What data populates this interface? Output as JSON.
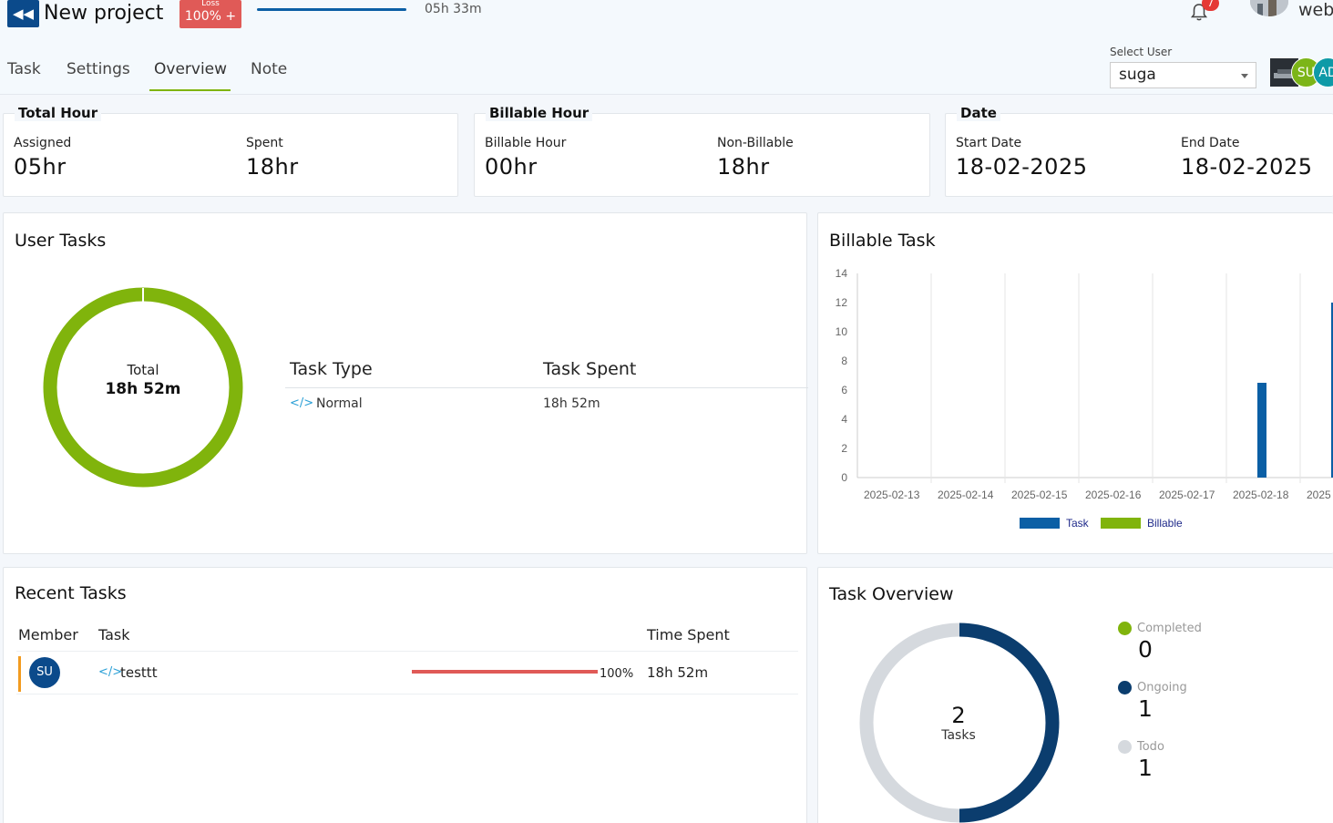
{
  "header": {
    "back_icon": "double-chevron-left-icon",
    "project_title": "New project",
    "loss_label": "Loss",
    "loss_value": "100% +",
    "progress_percent": 100,
    "elapsed_time": "05h 33m",
    "notification_count": "7",
    "user_name": "web"
  },
  "tabs": [
    {
      "label": "Task"
    },
    {
      "label": "Settings"
    },
    {
      "label": "Overview",
      "active": true
    },
    {
      "label": "Note"
    }
  ],
  "user_select": {
    "label": "Select User",
    "value": "suga"
  },
  "avatars": [
    {
      "initials": "",
      "color": "#2a2f35"
    },
    {
      "initials": "SU",
      "color": "#7cb518"
    },
    {
      "initials": "AD",
      "color": "#0e9aa7"
    }
  ],
  "total_hour": {
    "title": "Total Hour",
    "assigned_label": "Assigned",
    "assigned_value": "05hr",
    "spent_label": "Spent",
    "spent_value": "18hr"
  },
  "billable_hour": {
    "title": "Billable Hour",
    "billable_label": "Billable Hour",
    "billable_value": "00hr",
    "nonbillable_label": "Non-Billable",
    "nonbillable_value": "18hr"
  },
  "date": {
    "title": "Date",
    "start_label": "Start Date",
    "start_value": "18-02-2025",
    "end_label": "End Date",
    "end_value": "18-02-2025"
  },
  "user_tasks": {
    "title": "User Tasks",
    "center_label": "Total",
    "center_value": "18h 52m",
    "ring_color": "#80b40c",
    "table_headers": [
      "Task Type",
      "Task Spent"
    ],
    "rows": [
      {
        "icon": "code-icon",
        "type": "Normal",
        "spent": "18h 52m"
      }
    ]
  },
  "billable_task": {
    "title": "Billable Task"
  },
  "chart_data": {
    "type": "bar",
    "categories": [
      "2025-02-13",
      "2025-02-14",
      "2025-02-15",
      "2025-02-16",
      "2025-02-17",
      "2025-02-18",
      "2025"
    ],
    "series": [
      {
        "name": "Task",
        "color": "#0b5fa5",
        "values": [
          0,
          0,
          0,
          0,
          0,
          6.5,
          12
        ]
      },
      {
        "name": "Billable",
        "color": "#80b40c",
        "values": [
          0,
          0,
          0,
          0,
          0,
          0,
          0
        ]
      }
    ],
    "yticks": [
      "0",
      "2",
      "4",
      "6",
      "8",
      "10",
      "12",
      "14"
    ],
    "ylim": [
      0,
      14
    ],
    "grid": true,
    "legend": "bottom"
  },
  "recent_tasks": {
    "title": "Recent Tasks",
    "headers": [
      "Member",
      "Task",
      "Time Spent"
    ],
    "rows": [
      {
        "member": "SU",
        "icon": "code-icon",
        "task": "testtt",
        "progress_label": "100%",
        "progress": 100,
        "time": "18h 52m"
      }
    ]
  },
  "task_overview": {
    "title": "Task Overview",
    "center_value": "2",
    "center_label": "Tasks",
    "items": [
      {
        "label": "Completed",
        "value": "0",
        "color": "#80b40c"
      },
      {
        "label": "Ongoing",
        "value": "1",
        "color": "#0b3d6e"
      },
      {
        "label": "Todo",
        "value": "1",
        "color": "#d5d9de"
      }
    ]
  }
}
